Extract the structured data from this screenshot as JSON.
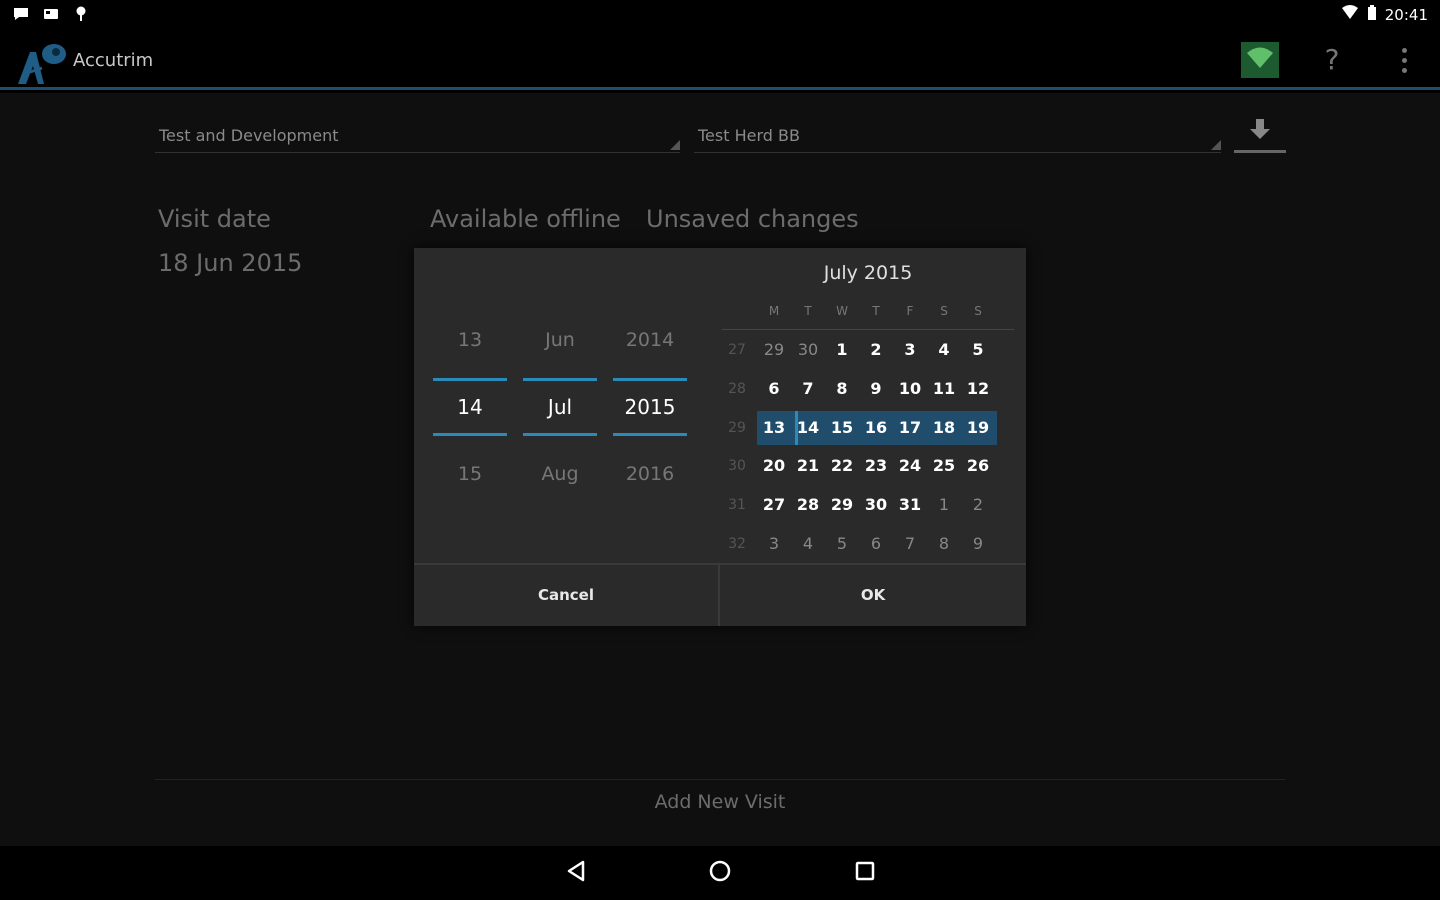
{
  "status_bar": {
    "time": "20:41",
    "left_icons": [
      "chat-bubble-icon",
      "photo-icon",
      "pin-icon"
    ],
    "right_icons": [
      "wifi-icon",
      "battery-icon"
    ]
  },
  "app_bar": {
    "title": "Accutrim",
    "actions": [
      "wifi-sync-icon",
      "help-icon",
      "overflow-menu-icon"
    ],
    "help_glyph": "?"
  },
  "filters": {
    "organisation": "Test and Development",
    "herd": "Test Herd BB",
    "download_icon": "download-icon"
  },
  "labels": {
    "visit_date": "Visit date",
    "visit_date_value": "18 Jun 2015",
    "available_offline": "Available offline",
    "unsaved_changes": "Unsaved changes"
  },
  "date_dialog": {
    "picker": {
      "day": {
        "prev": "13",
        "current": "14",
        "next": "15"
      },
      "month": {
        "prev": "Jun",
        "current": "Jul",
        "next": "Aug"
      },
      "year": {
        "prev": "2014",
        "current": "2015",
        "next": "2016"
      }
    },
    "calendar": {
      "title": "July 2015",
      "weekdays": [
        "M",
        "T",
        "W",
        "T",
        "F",
        "S",
        "S"
      ],
      "weeks": [
        {
          "num": "27",
          "days": [
            "29",
            "30",
            "1",
            "2",
            "3",
            "4",
            "5"
          ],
          "dim": [
            true,
            true,
            false,
            false,
            false,
            false,
            false
          ]
        },
        {
          "num": "28",
          "days": [
            "6",
            "7",
            "8",
            "9",
            "10",
            "11",
            "12"
          ],
          "dim": [
            false,
            false,
            false,
            false,
            false,
            false,
            false
          ]
        },
        {
          "num": "29",
          "days": [
            "13",
            "14",
            "15",
            "16",
            "17",
            "18",
            "19"
          ],
          "dim": [
            false,
            false,
            false,
            false,
            false,
            false,
            false
          ]
        },
        {
          "num": "30",
          "days": [
            "20",
            "21",
            "22",
            "23",
            "24",
            "25",
            "26"
          ],
          "dim": [
            false,
            false,
            false,
            false,
            false,
            false,
            false
          ]
        },
        {
          "num": "31",
          "days": [
            "27",
            "28",
            "29",
            "30",
            "31",
            "1",
            "2"
          ],
          "dim": [
            false,
            false,
            false,
            false,
            false,
            true,
            true
          ]
        },
        {
          "num": "32",
          "days": [
            "3",
            "4",
            "5",
            "6",
            "7",
            "8",
            "9"
          ],
          "dim": [
            true,
            true,
            true,
            true,
            true,
            true,
            true
          ]
        }
      ],
      "selected_day": "14"
    },
    "cancel_label": "Cancel",
    "ok_label": "OK"
  },
  "footer": {
    "add_visit": "Add New Visit"
  },
  "colors": {
    "accent": "#2a8ab8",
    "selection": "#1f4d6b",
    "action_bar_divider": "#1f4d6b",
    "sync_button": "#1d5a2f"
  }
}
